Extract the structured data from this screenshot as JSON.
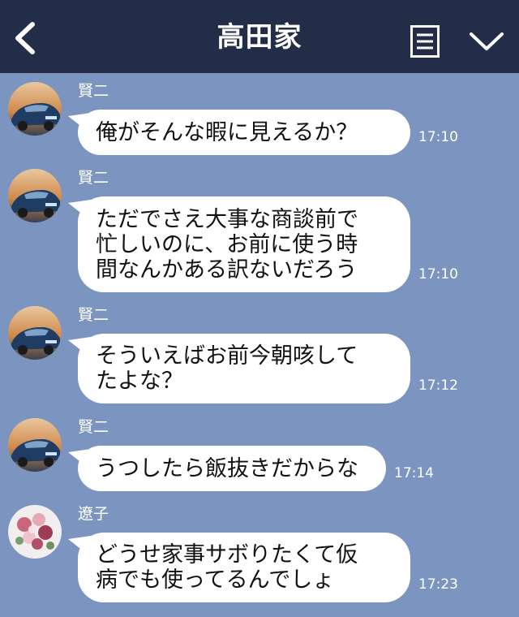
{
  "header": {
    "title": "高田家",
    "back_icon": "chevron-left-icon",
    "menu_icon": "list-icon",
    "expand_icon": "chevron-down-icon"
  },
  "messages": [
    {
      "sender": "賢二",
      "avatar": "car-avatar",
      "lines": [
        "俺がそんな暇に見えるか？"
      ],
      "time": "17:10"
    },
    {
      "sender": "賢二",
      "avatar": "car-avatar",
      "lines": [
        "ただでさえ大事な商談前で",
        "忙しいのに、お前に使う時",
        "間なんかある訳ないだろう"
      ],
      "time": "17:10"
    },
    {
      "sender": "賢二",
      "avatar": "car-avatar",
      "lines": [
        "そういえばお前今朝咳して",
        "たよな？"
      ],
      "time": "17:12"
    },
    {
      "sender": "賢二",
      "avatar": "car-avatar",
      "lines": [
        "うつしたら飯抜きだからな"
      ],
      "time": "17:14"
    },
    {
      "sender": "遼子",
      "avatar": "flower-avatar",
      "lines": [
        "どうせ家事サボりたくて仮",
        "病でも使ってるんでしょ"
      ],
      "time": "17:23"
    }
  ],
  "colors": {
    "header": "#232d47",
    "background": "#7b94c0",
    "bubble": "#ffffff"
  }
}
